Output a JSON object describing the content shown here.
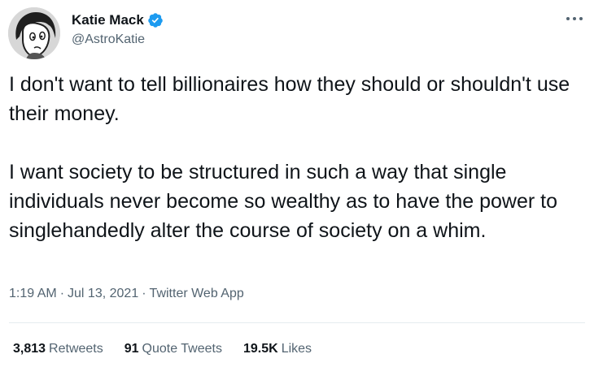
{
  "author": {
    "display_name": "Katie Mack",
    "handle": "@AstroKatie",
    "verified": true,
    "avatar_icon": "cartoon-avatar-icon"
  },
  "tweet": {
    "paragraphs": [
      "I don't want to tell billionaires how they should or shouldn't use their money.",
      "I want society to be structured in such a way that single individuals never become so wealthy as to have the power to singlehandedly alter the course of society on a whim."
    ],
    "time": "1:19 AM",
    "separator": "·",
    "date": "Jul 13, 2021",
    "source": "Twitter Web App"
  },
  "stats": {
    "retweets": {
      "count": "3,813",
      "label": "Retweets"
    },
    "quote_tweets": {
      "count": "91",
      "label": "Quote Tweets"
    },
    "likes": {
      "count": "19.5K",
      "label": "Likes"
    }
  },
  "colors": {
    "text": "#0f1419",
    "secondary": "#536471",
    "verified_blue": "#1d9bf0",
    "divider": "#e6ecf0"
  },
  "icons": {
    "verified": "verified-badge-icon",
    "more": "more-options-icon"
  }
}
